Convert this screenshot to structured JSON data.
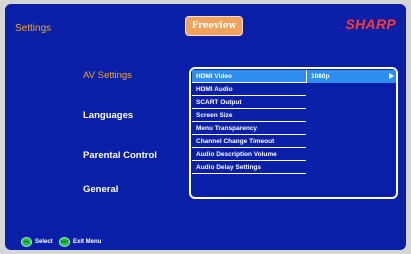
{
  "header": {
    "title": "Settings",
    "brand_logo": "Freeview",
    "maker_logo": "SHARP"
  },
  "categories": [
    {
      "label": "AV Settings",
      "active": true
    },
    {
      "label": "Languages",
      "active": false
    },
    {
      "label": "Parental Control",
      "active": false
    },
    {
      "label": "General",
      "active": false
    }
  ],
  "menu": {
    "items": [
      "HDMI Video",
      "HDMI Audio",
      "SCART Output",
      "Screen Size",
      "Menu Transparency",
      "Channel Change Timeout",
      "Audio Description Volume",
      "Audio Delay Settings"
    ],
    "selected_index": 0,
    "selected_value": "1080p",
    "arrow_icon": "right-arrow-icon"
  },
  "footer": {
    "select_label": "Select",
    "select_button": "OK",
    "exit_label": "Exit Menu",
    "exit_button": "EXIT"
  },
  "colors": {
    "background": "#0a1fa8",
    "accent": "#f5a623",
    "highlight": "#2c8ff0",
    "maker": "#ff3b30",
    "button": "#27c249"
  }
}
